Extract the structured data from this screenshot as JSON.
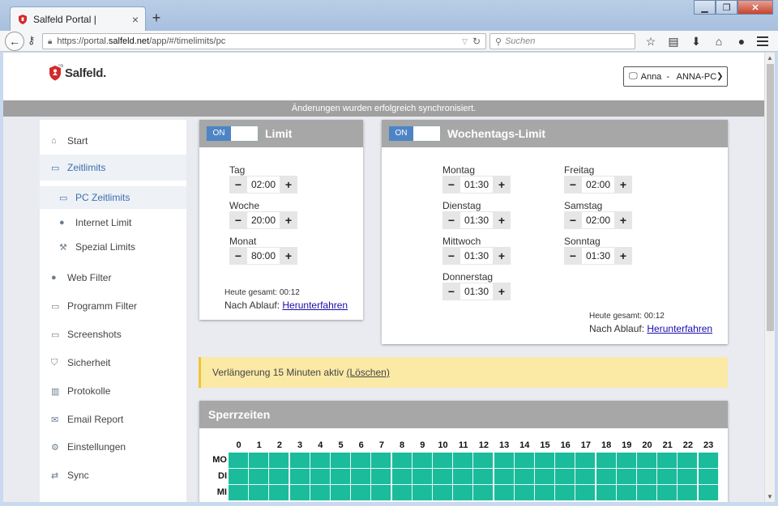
{
  "browser": {
    "tab_title": "Salfeld Portal |",
    "tab_close": "×",
    "new_tab": "+",
    "url_prefix": "https://portal.",
    "url_domain": "salfeld.net",
    "url_path": "/app/#/timelimits/pc",
    "search_placeholder": "Suchen"
  },
  "header": {
    "logo_text": "Salfeld.",
    "device_label": "Anna  -   ANNA-PC"
  },
  "sync_message": "Änderungen wurden erfolgreich synchronisiert.",
  "sidebar": {
    "items": [
      {
        "label": "Start",
        "icon": "home-icon"
      },
      {
        "label": "Zeitlimits",
        "icon": "monitor-icon"
      },
      {
        "label": "PC Zeitlimits",
        "icon": "monitor-icon"
      },
      {
        "label": "Internet Limit",
        "icon": "globe-icon"
      },
      {
        "label": "Spezial Limits",
        "icon": "wrench-icon"
      },
      {
        "label": "Web Filter",
        "icon": "globe-icon"
      },
      {
        "label": "Programm Filter",
        "icon": "laptop-icon"
      },
      {
        "label": "Screenshots",
        "icon": "monitor-icon"
      },
      {
        "label": "Sicherheit",
        "icon": "shield-icon"
      },
      {
        "label": "Protokolle",
        "icon": "bar-chart-icon"
      },
      {
        "label": "Email Report",
        "icon": "envelope-icon"
      },
      {
        "label": "Einstellungen",
        "icon": "gear-icon"
      },
      {
        "label": "Sync",
        "icon": "sync-icon"
      }
    ]
  },
  "limit_card": {
    "toggle": "ON",
    "title": "Limit",
    "rows": [
      {
        "label": "Tag",
        "value": "02:00"
      },
      {
        "label": "Woche",
        "value": "20:00"
      },
      {
        "label": "Monat",
        "value": "80:00"
      }
    ],
    "today_total": "Heute gesamt: 00:12",
    "after_label": "Nach Ablauf:",
    "after_action": "Herunterfahren"
  },
  "weekday_card": {
    "toggle": "ON",
    "title": "Wochentags-Limit",
    "days": [
      {
        "label": "Montag",
        "value": "01:30"
      },
      {
        "label": "Dienstag",
        "value": "01:30"
      },
      {
        "label": "Mittwoch",
        "value": "01:30"
      },
      {
        "label": "Donnerstag",
        "value": "01:30"
      },
      {
        "label": "Freitag",
        "value": "02:00"
      },
      {
        "label": "Samstag",
        "value": "02:00"
      },
      {
        "label": "Sonntag",
        "value": "01:30"
      }
    ],
    "today_total": "Heute gesamt: 00:12",
    "after_label": "Nach Ablauf:",
    "after_action": "Herunterfahren"
  },
  "extension": {
    "text": "Verlängerung 15 Minuten aktiv",
    "link": "(Löschen)"
  },
  "lock_times": {
    "title": "Sperrzeiten",
    "hours": [
      "0",
      "1",
      "2",
      "3",
      "4",
      "5",
      "6",
      "7",
      "8",
      "9",
      "10",
      "11",
      "12",
      "13",
      "14",
      "15",
      "16",
      "17",
      "18",
      "19",
      "20",
      "21",
      "22",
      "23"
    ],
    "days": [
      "MO",
      "DI",
      "MI"
    ]
  },
  "stepper": {
    "minus": "−",
    "plus": "+"
  }
}
